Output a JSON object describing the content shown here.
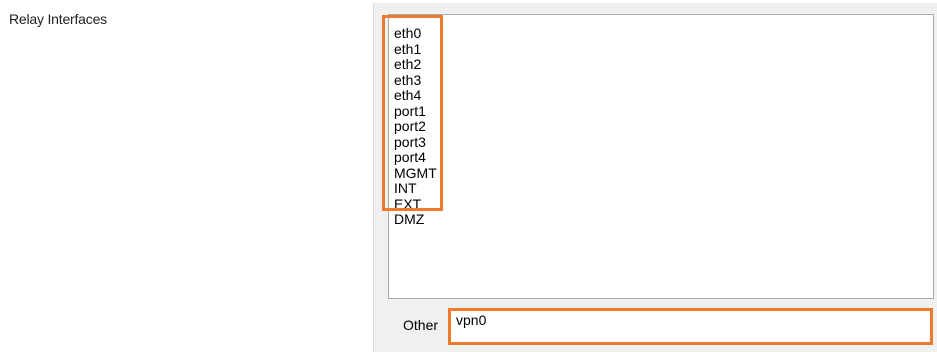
{
  "relay": {
    "label": "Relay Interfaces",
    "interfaces": [
      "eth0",
      "eth1",
      "eth2",
      "eth3",
      "eth4",
      "port1",
      "port2",
      "port3",
      "port4",
      "MGMT",
      "INT",
      "EXT",
      "DMZ"
    ],
    "other_label": "Other",
    "other_value": "vpn0"
  },
  "colors": {
    "highlight": "#ee7a2f",
    "panel_background": "#f0f0f0",
    "listbox_border": "#a9a9a9"
  }
}
